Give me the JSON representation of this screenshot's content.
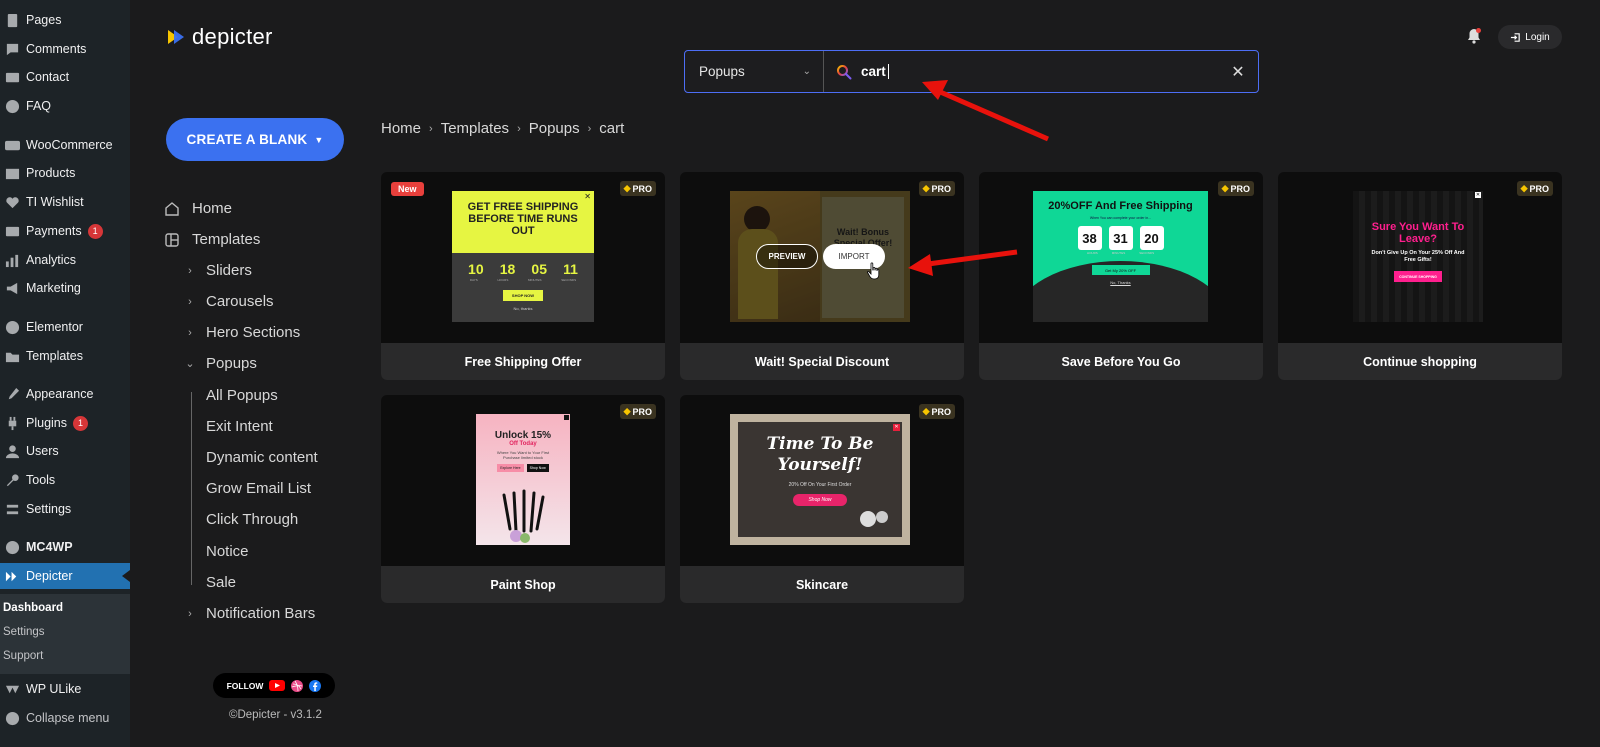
{
  "wp_menu": {
    "items": [
      {
        "label": "Pages",
        "icon": "pages-icon"
      },
      {
        "label": "Comments",
        "icon": "comments-icon"
      },
      {
        "label": "Contact",
        "icon": "contact-icon"
      },
      {
        "label": "FAQ",
        "icon": "faq-icon"
      },
      {
        "label": "WooCommerce",
        "icon": "woocommerce-icon"
      },
      {
        "label": "Products",
        "icon": "products-icon"
      },
      {
        "label": "TI Wishlist",
        "icon": "wishlist-icon"
      },
      {
        "label": "Payments",
        "icon": "payments-icon",
        "badge": "1"
      },
      {
        "label": "Analytics",
        "icon": "analytics-icon"
      },
      {
        "label": "Marketing",
        "icon": "marketing-icon"
      },
      {
        "label": "Elementor",
        "icon": "elementor-icon"
      },
      {
        "label": "Templates",
        "icon": "templates-icon"
      },
      {
        "label": "Appearance",
        "icon": "appearance-icon"
      },
      {
        "label": "Plugins",
        "icon": "plugins-icon",
        "badge": "1"
      },
      {
        "label": "Users",
        "icon": "users-icon"
      },
      {
        "label": "Tools",
        "icon": "tools-icon"
      },
      {
        "label": "Settings",
        "icon": "settings-icon"
      },
      {
        "label": "MC4WP",
        "icon": "mc4wp-icon"
      },
      {
        "label": "Depicter",
        "icon": "depicter-icon",
        "active": true
      },
      {
        "label": "WP ULike",
        "icon": "wpulike-icon"
      },
      {
        "label": "Collapse menu",
        "icon": "collapse-icon"
      }
    ],
    "submenu": [
      "Dashboard",
      "Settings",
      "Support"
    ]
  },
  "app": {
    "logo_text": "depicter",
    "login_label": "Login",
    "create_blank_label": "CREATE A BLANK",
    "search": {
      "category": "Popups",
      "query": "cart"
    },
    "nav": {
      "home": "Home",
      "templates": "Templates",
      "sliders": "Sliders",
      "carousels": "Carousels",
      "hero_sections": "Hero Sections",
      "popups": "Popups",
      "popup_children": [
        "All Popups",
        "Exit Intent",
        "Dynamic content",
        "Grow Email List",
        "Click Through",
        "Notice",
        "Sale"
      ],
      "notification_bars": "Notification Bars"
    },
    "breadcrumb": [
      "Home",
      "Templates",
      "Popups",
      "cart"
    ],
    "follow_label": "FOLLOW",
    "copyright": "©Depicter - v3.1.2"
  },
  "templates": [
    {
      "title": "Free Shipping Offer",
      "badge_new": "New",
      "pro": "PRO",
      "thumb": {
        "headline": "GET FREE SHIPPING BEFORE TIME RUNS OUT",
        "timer": [
          "10",
          "18",
          "05",
          "11"
        ],
        "timer_units": [
          "DAYS",
          "HOURS",
          "MINUTES",
          "SECONDS"
        ],
        "button": "SHOP NOW",
        "link": "No, thanks"
      }
    },
    {
      "title": "Wait! Special Discount",
      "pro": "PRO",
      "thumb": {
        "headline": "Wait! Bonus Special Offer!",
        "preview_label": "PREVIEW",
        "import_label": "IMPORT"
      }
    },
    {
      "title": "Save Before You Go",
      "pro": "PRO",
      "thumb": {
        "headline": "20%OFF And Free Shipping",
        "sub": "When You can complete your order in...",
        "timer": [
          "38",
          "31",
          "20"
        ],
        "timer_units": [
          "HOURS",
          "MINUTES",
          "SECONDS"
        ],
        "button": "Get My 20% OFF",
        "link": "No, Thanks"
      }
    },
    {
      "title": "Continue shopping",
      "pro": "PRO",
      "thumb": {
        "headline": "Sure You Want To Leave?",
        "sub": "Don't Give Up On Your 25% Off And Free Gifts!",
        "button": "CONTINUE SHOPPING"
      }
    },
    {
      "title": "Paint Shop",
      "pro": "PRO",
      "thumb": {
        "headline": "Unlock 15%",
        "sub": "Off Today",
        "body": "Where You Want to Your First Purchase limited stock",
        "btn1": "Explore Here",
        "btn2": "Shop Now"
      }
    },
    {
      "title": "Skincare",
      "pro": "PRO",
      "thumb": {
        "headline": "Time To Be Yourself!",
        "sub": "20% Off On Your First Order",
        "button": "Shop Now"
      }
    }
  ],
  "colors": {
    "accent": "#3b71f0",
    "wp_active": "#2271b1",
    "badge_red": "#d63638",
    "annotation_red": "#e8120c"
  }
}
